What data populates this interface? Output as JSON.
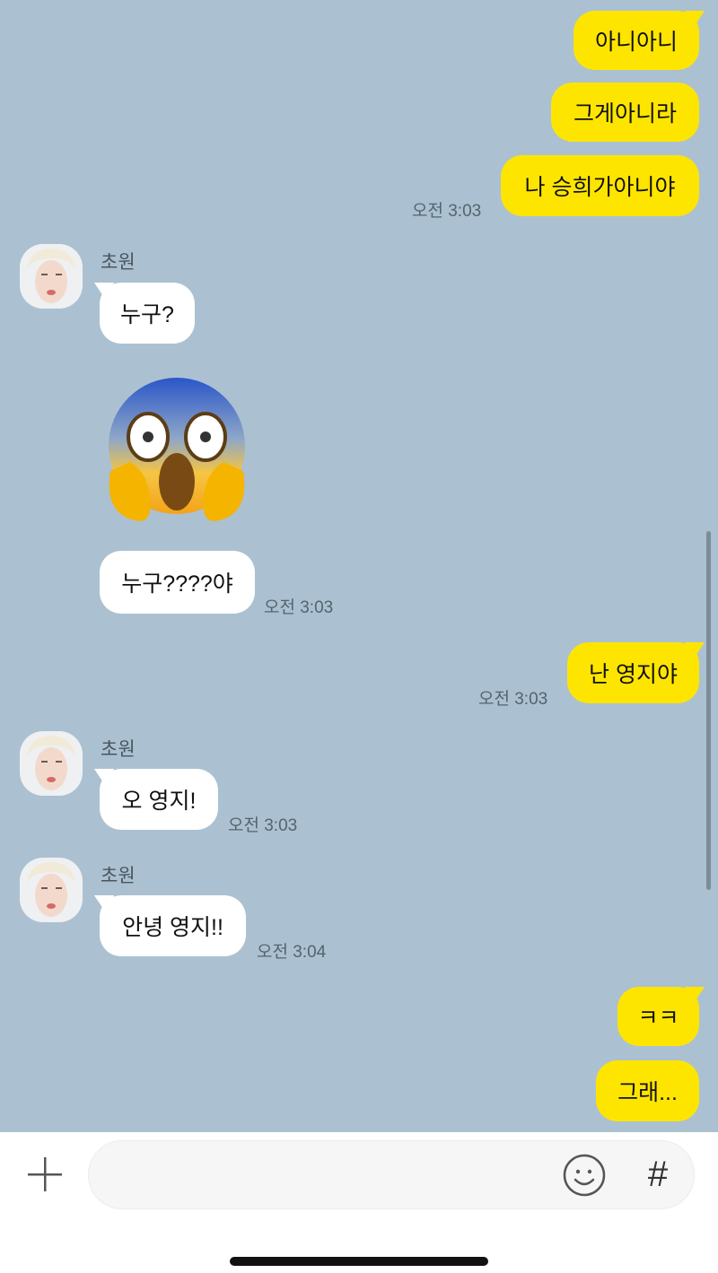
{
  "chat": {
    "messages": [
      {
        "side": "me",
        "text": "아니아니"
      },
      {
        "side": "me",
        "text": "그게아니라"
      },
      {
        "side": "me",
        "text": "나 승희가아니야",
        "time": "오전 3:03"
      },
      {
        "side": "them",
        "sender": "초원",
        "text": "누구?"
      },
      {
        "side": "them",
        "type": "emoji",
        "emoji_name": "face-screaming-in-fear-emoji"
      },
      {
        "side": "them",
        "text": "누구????야",
        "time": "오전 3:03"
      },
      {
        "side": "me",
        "text": "난 영지야",
        "time": "오전 3:03"
      },
      {
        "side": "them",
        "sender": "초원",
        "text": "오 영지!",
        "time": "오전 3:03"
      },
      {
        "side": "them",
        "sender": "초원",
        "text": "안녕 영지!!",
        "time": "오전 3:04"
      },
      {
        "side": "me",
        "text": "ㅋㅋ"
      },
      {
        "side": "me",
        "text": "그래..."
      }
    ]
  },
  "composer": {
    "placeholder": "",
    "plus_icon": "plus-icon",
    "emoji_icon": "smiley-icon",
    "hash_label": "#"
  },
  "colors": {
    "chat_bg": "#abc1d1",
    "my_bubble": "#fee500",
    "their_bubble": "#ffffff"
  }
}
